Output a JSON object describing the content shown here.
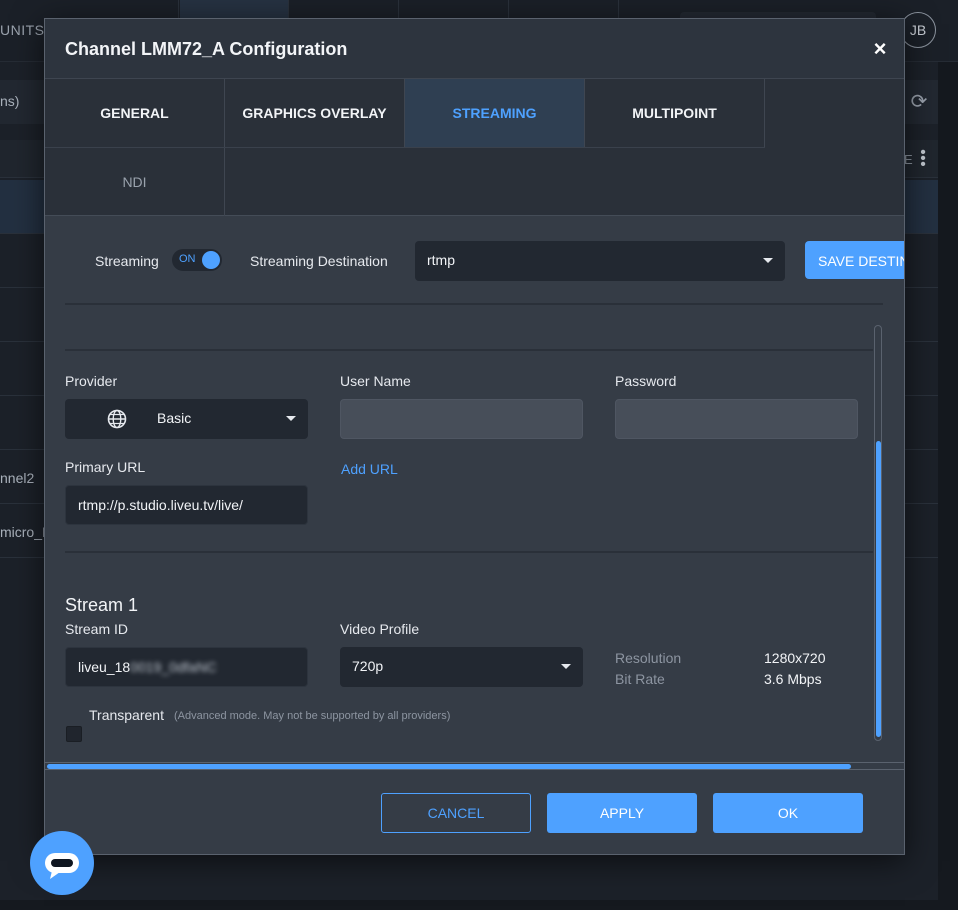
{
  "background": {
    "nav_label": "UNITS",
    "toolbar_text": "ns)",
    "avatar_initials": "JB",
    "header_fragment": "E",
    "rows": [
      "nnel2",
      "micro_Ir"
    ]
  },
  "modal": {
    "title": "Channel LMM72_A Configuration",
    "close_label": "×",
    "tabs": [
      "GENERAL",
      "GRAPHICS OVERLAY",
      "STREAMING",
      "MULTIPOINT",
      "NDI"
    ],
    "active_tab": "STREAMING",
    "streaming": {
      "label": "Streaming",
      "toggle_state": "ON",
      "destination_label": "Streaming Destination",
      "destination_value": "rtmp",
      "save_button": "SAVE DESTIN"
    },
    "provider": {
      "label": "Provider",
      "value": "Basic",
      "icon": "globe-icon"
    },
    "user_name": {
      "label": "User Name",
      "value": ""
    },
    "password": {
      "label": "Password",
      "value": ""
    },
    "primary_url": {
      "label": "Primary URL",
      "value": "rtmp://p.studio.liveu.tv/live/",
      "add_url_link": "Add URL"
    },
    "stream": {
      "title": "Stream 1",
      "stream_id_label": "Stream ID",
      "stream_id_value": "liveu_18",
      "stream_id_obscured": "0019_0dfaNC",
      "video_profile_label": "Video Profile",
      "video_profile_value": "720p",
      "resolution_label": "Resolution",
      "resolution_value": "1280x720",
      "bitrate_label": "Bit Rate",
      "bitrate_value": "3.6 Mbps",
      "transparent_label": "Transparent",
      "transparent_note": "(Advanced mode. May not be supported by all providers)",
      "transparent_checked": false
    },
    "footer": {
      "cancel": "CANCEL",
      "apply": "APPLY",
      "ok": "OK"
    }
  },
  "colors": {
    "accent": "#4ea1ff",
    "modal_bg": "#353c46",
    "field_bg": "#222831"
  }
}
